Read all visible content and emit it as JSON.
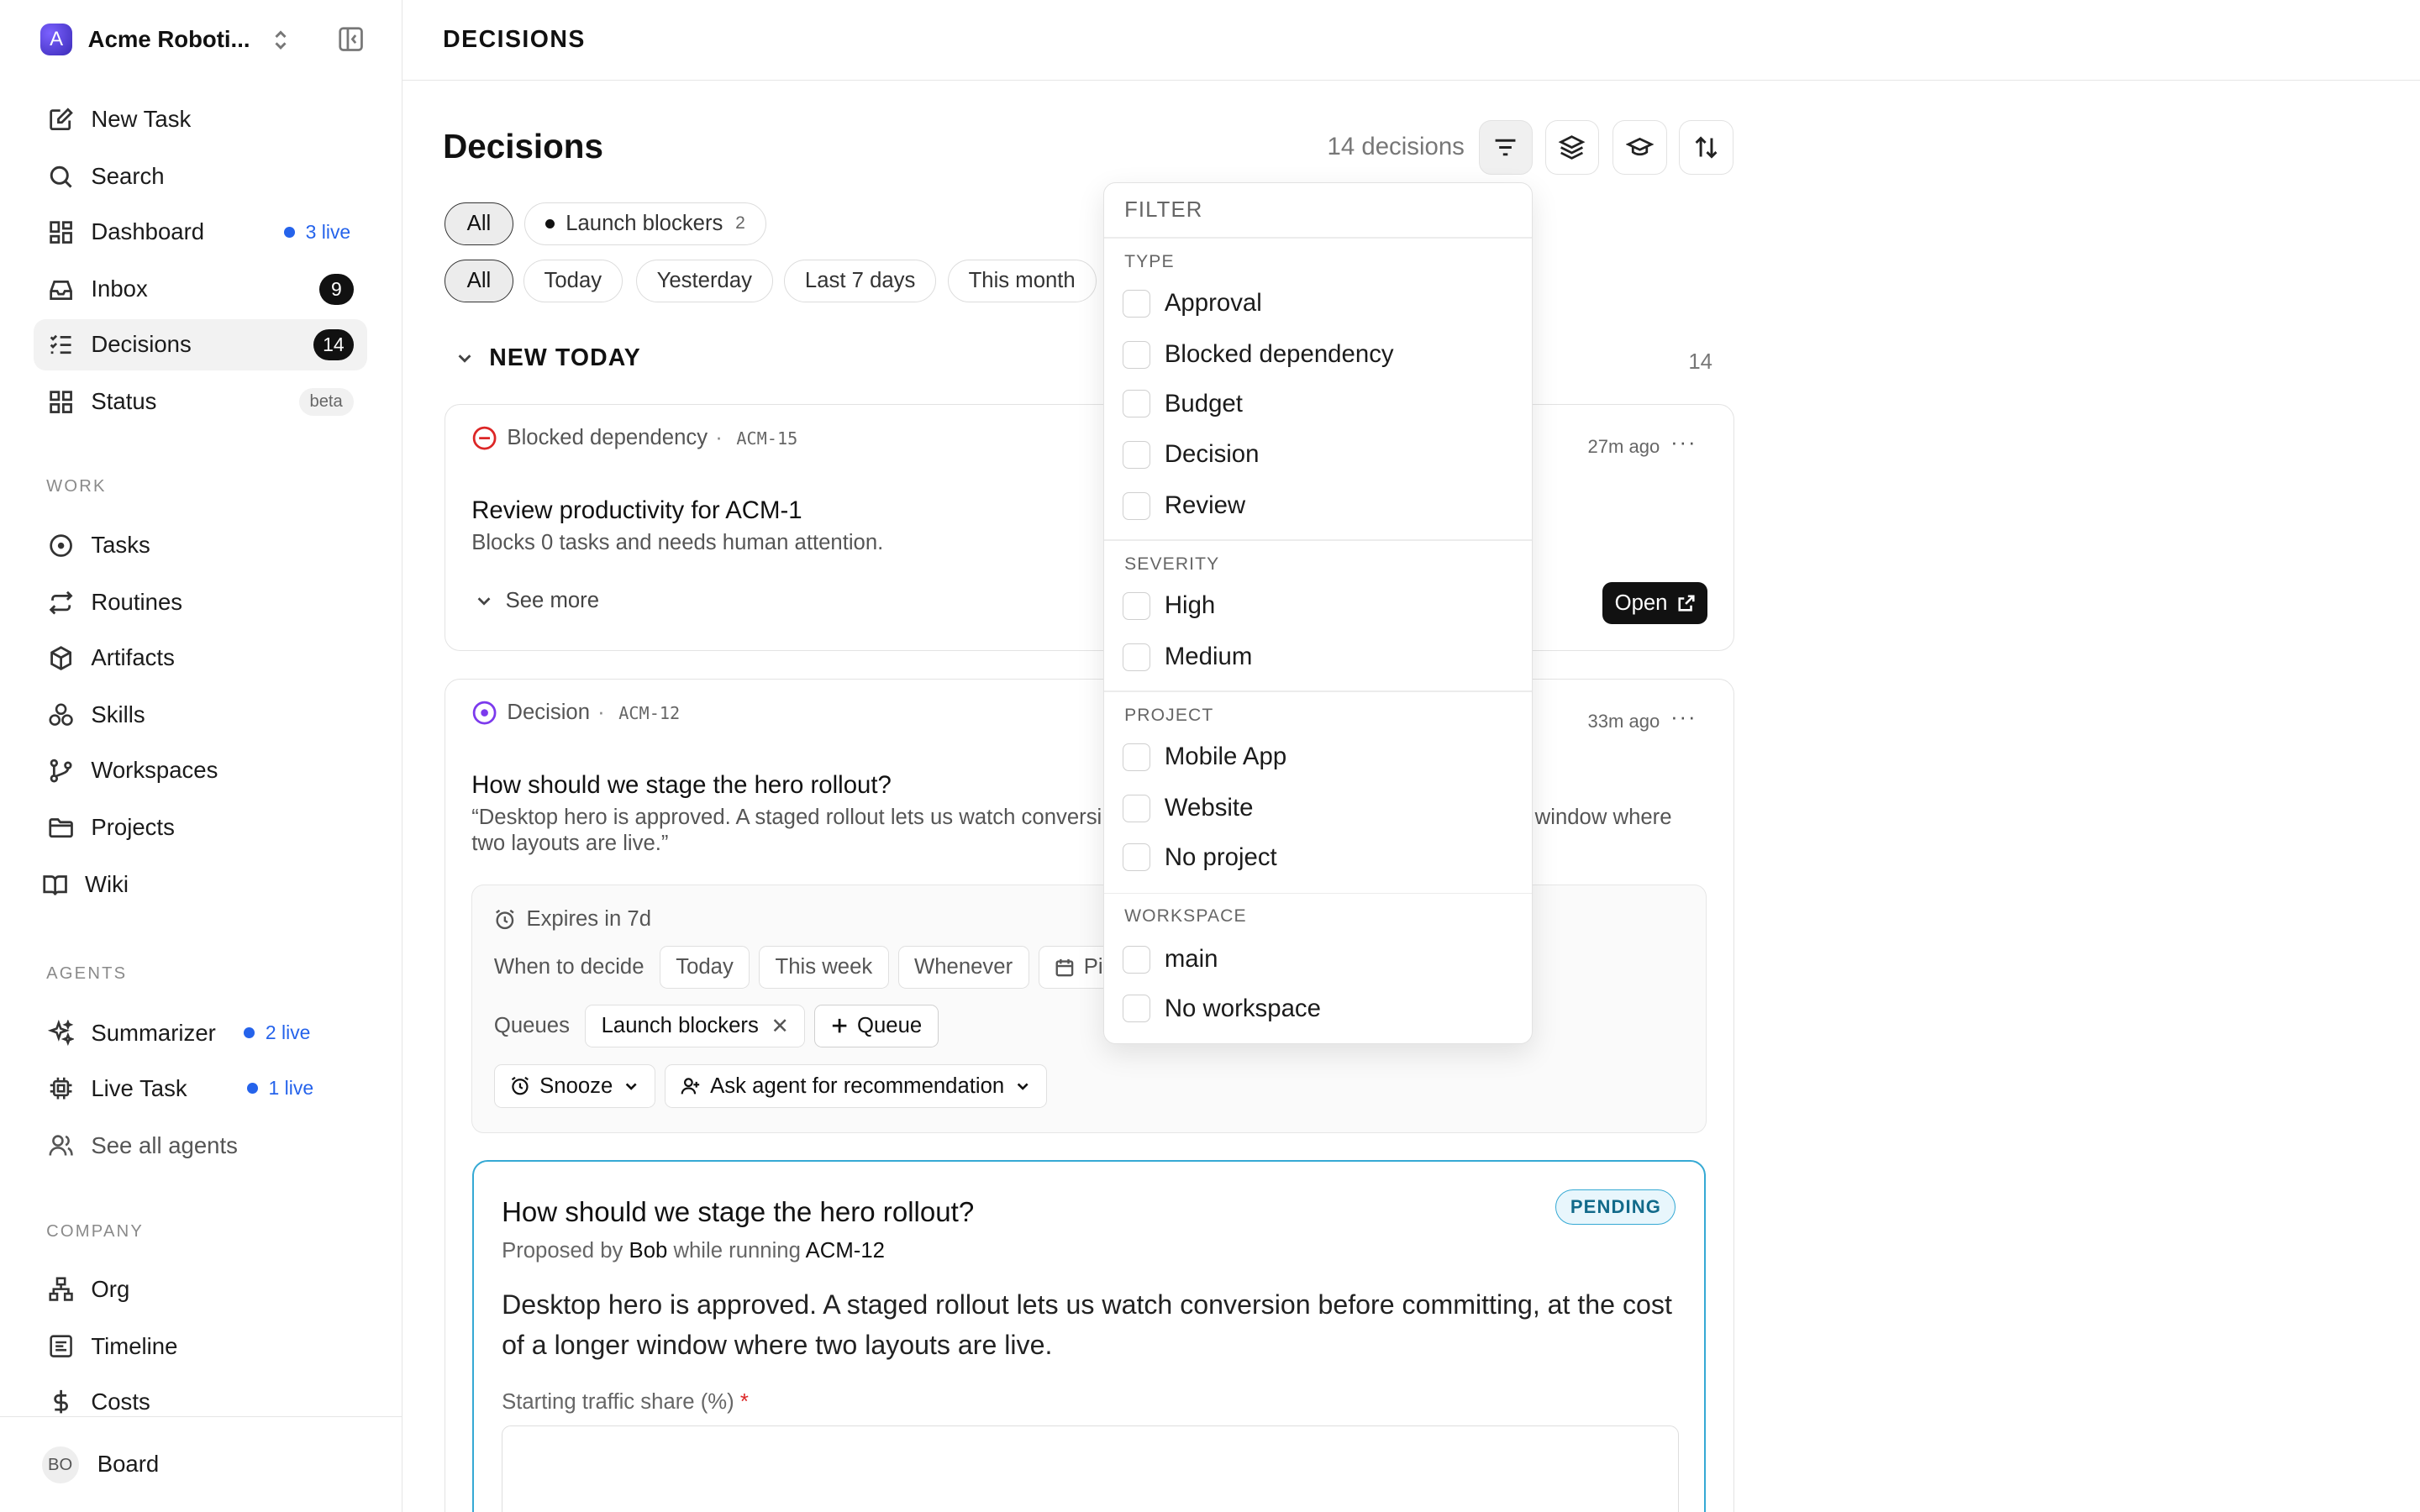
{
  "workspace": {
    "initial": "A",
    "name": "Acme Roboti..."
  },
  "sidebar": {
    "primary": [
      {
        "label": "New Task"
      },
      {
        "label": "Search"
      },
      {
        "label": "Dashboard",
        "live": "3 live"
      },
      {
        "label": "Inbox",
        "count": "9"
      },
      {
        "label": "Decisions",
        "count": "14"
      },
      {
        "label": "Status",
        "badge": "beta"
      }
    ],
    "work_label": "WORK",
    "work": [
      {
        "label": "Tasks"
      },
      {
        "label": "Routines"
      },
      {
        "label": "Artifacts"
      },
      {
        "label": "Skills"
      },
      {
        "label": "Workspaces"
      },
      {
        "label": "Projects"
      },
      {
        "label": "Wiki"
      }
    ],
    "agents_label": "AGENTS",
    "agents": [
      {
        "label": "Summarizer",
        "live": "2 live"
      },
      {
        "label": "Live Task",
        "live": "1 live"
      },
      {
        "label": "See all agents"
      }
    ],
    "company_label": "COMPANY",
    "company": [
      {
        "label": "Org"
      },
      {
        "label": "Timeline"
      },
      {
        "label": "Costs"
      }
    ],
    "user": {
      "initials": "BO",
      "name": "Board"
    }
  },
  "header": {
    "breadcrumb": "DECISIONS"
  },
  "main": {
    "title": "Decisions",
    "count_label": "14 decisions",
    "queue_chips": [
      {
        "label": "All"
      },
      {
        "label": "Launch blockers",
        "count": "2"
      }
    ],
    "date_chips": [
      "All",
      "Today",
      "Yesterday",
      "Last 7 days",
      "This month"
    ],
    "group": {
      "label": "NEW TODAY",
      "count": "14"
    },
    "card1": {
      "type": "Blocked dependency",
      "id": "ACM-15",
      "ago": "27m ago",
      "title": "Review productivity for ACM-1",
      "desc": "Blocks 0 tasks and needs human attention.",
      "see_more": "See more",
      "open": "Open"
    },
    "card2": {
      "type": "Decision",
      "id": "ACM-12",
      "ago": "33m ago",
      "title": "How should we stage the hero rollout?",
      "quote_line1_left": "“Desktop hero is approved. A staged rollout lets us watch conversi",
      "quote_line1_right": "window where",
      "quote_line2": "two layouts are live.”",
      "expires": "Expires in 7d",
      "when_label": "When to decide",
      "when_options": [
        "Today",
        "This week",
        "Whenever",
        "Pick"
      ],
      "queues_label": "Queues",
      "queue_tag": "Launch blockers",
      "add_queue": "Queue",
      "snooze": "Snooze",
      "ask_agent": "Ask agent for recommendation"
    },
    "proposal": {
      "title": "How should we stage the hero rollout?",
      "status": "PENDING",
      "proposed_by": "Proposed by",
      "author": "Bob",
      "while_running": "while running",
      "task": "ACM-12",
      "body": "Desktop hero is approved. A staged rollout lets us watch conversion before committing, at the cost of a longer window where two layouts are live.",
      "field_label": "Starting traffic share (%)",
      "required_mark": "*"
    }
  },
  "filter": {
    "heading": "FILTER",
    "type_label": "TYPE",
    "types": [
      "Approval",
      "Blocked dependency",
      "Budget",
      "Decision",
      "Review"
    ],
    "severity_label": "SEVERITY",
    "severities": [
      "High",
      "Medium"
    ],
    "project_label": "PROJECT",
    "projects": [
      "Mobile App",
      "Website",
      "No project"
    ],
    "workspace_label": "WORKSPACE",
    "workspaces": [
      "main",
      "No workspace"
    ]
  }
}
